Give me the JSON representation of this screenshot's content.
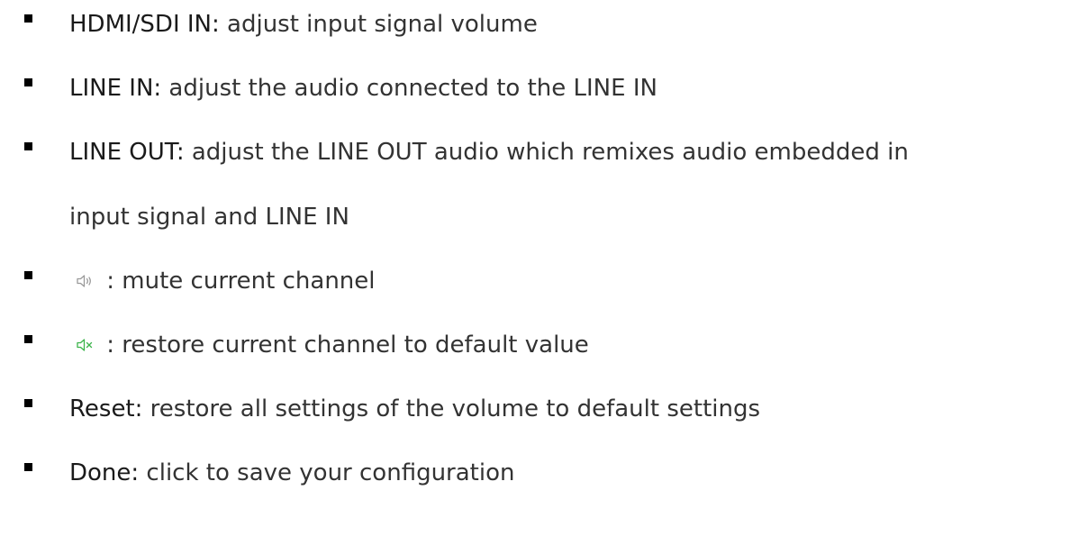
{
  "items": [
    {
      "term": "HDMI/SDI IN:",
      "desc": " adjust input signal volume"
    },
    {
      "term": "LINE IN:",
      "desc": " adjust the audio connected to the LINE IN"
    },
    {
      "term": "LINE OUT:",
      "desc": " adjust the LINE OUT audio which remixes audio embedded in",
      "desc2": "input signal and LINE IN"
    },
    {
      "icon": "speaker-icon",
      "icon_color": "#9a9a9a",
      "desc": " : mute current channel"
    },
    {
      "icon": "speaker-muted-icon",
      "icon_color": "#3cb44b",
      "desc": " : restore current channel to default value"
    },
    {
      "term": "Reset:",
      "desc": " restore all settings of the volume to default settings"
    },
    {
      "term": "Done:",
      "desc": " click to save your configuration"
    }
  ]
}
